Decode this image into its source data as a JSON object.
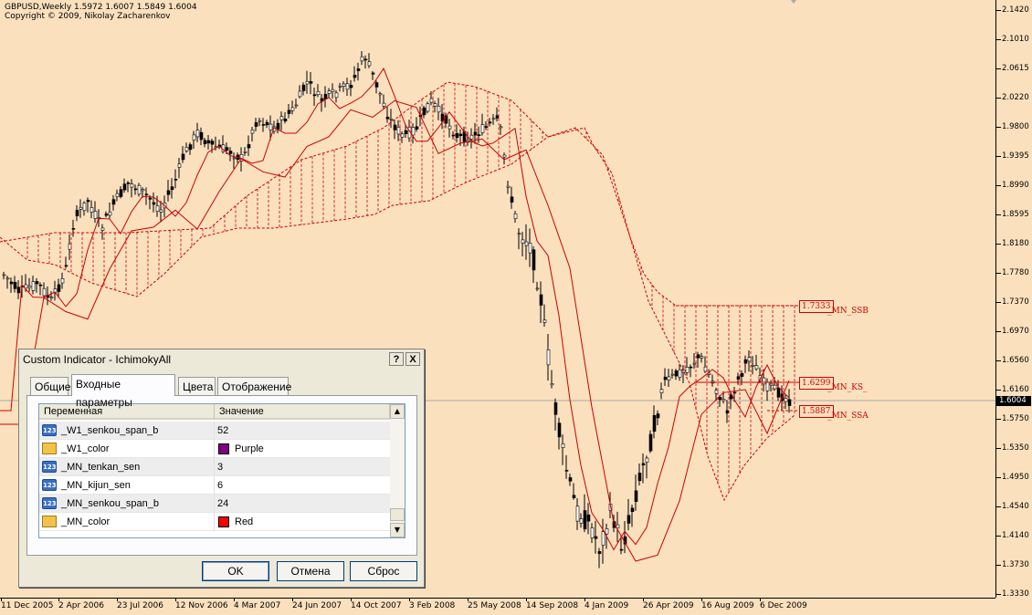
{
  "chart": {
    "header_line1": "GBPUSD,Weekly  1.5972 1.6007 1.5849 1.6004",
    "header_line2": "Copyright © 2009, Nikolay Zacharenkov",
    "current_price": "1.6004",
    "price_labels": [
      "2.1420",
      "2.1010",
      "2.0615",
      "2.0220",
      "1.9800",
      "1.9395",
      "1.8990",
      "1.8595",
      "1.8180",
      "1.7780",
      "1.7370",
      "1.6970",
      "1.6560",
      "1.6160",
      "1.5750",
      "1.5350",
      "1.4950",
      "1.4540",
      "1.4140",
      "1.3730",
      "1.3330"
    ],
    "time_labels": [
      "11 Dec 2005",
      "2 Apr 2006",
      "23 Jul 2006",
      "12 Nov 2006",
      "4 Mar 2007",
      "24 Jun 2007",
      "14 Oct 2007",
      "3 Feb 2008",
      "25 May 2008",
      "14 Sep 2008",
      "4 Jan 2009",
      "26 Apr 2009",
      "16 Aug 2009",
      "6 Dec 2009"
    ],
    "levels": [
      {
        "value": "1.7333",
        "name": "_MN_SSB"
      },
      {
        "value": "1.6299",
        "name": "_MN_KS_"
      },
      {
        "value": "1.5887",
        "name": "_MN_SSA"
      }
    ],
    "colors": {
      "background": "#FBE0BE",
      "candles": "#000000",
      "indicator": "#CC0000"
    }
  },
  "dialog": {
    "title": "Custom Indicator - IchimokyAll",
    "help_button": "?",
    "close_button": "X",
    "tabs": [
      "Общие",
      "Входные параметры",
      "Цвета",
      "Отображение"
    ],
    "active_tab": "Входные параметры",
    "columns": [
      "Переменная",
      "Значение"
    ],
    "rows": [
      {
        "icon": "numeric-param-icon",
        "name": "_W1_senkou_span_b",
        "value": "52"
      },
      {
        "icon": "color-param-icon",
        "name": "_W1_color",
        "value": "Purple",
        "swatch": "#800080"
      },
      {
        "icon": "numeric-param-icon",
        "name": "_MN_tenkan_sen",
        "value": "3"
      },
      {
        "icon": "numeric-param-icon",
        "name": "_MN_kijun_sen",
        "value": "6"
      },
      {
        "icon": "numeric-param-icon",
        "name": "_MN_senkou_span_b",
        "value": "24"
      },
      {
        "icon": "color-param-icon",
        "name": "_MN_color",
        "value": "Red",
        "swatch": "#FF0000"
      }
    ],
    "buttons": {
      "ok": "OK",
      "cancel": "Отмена",
      "reset": "Сброс"
    }
  }
}
